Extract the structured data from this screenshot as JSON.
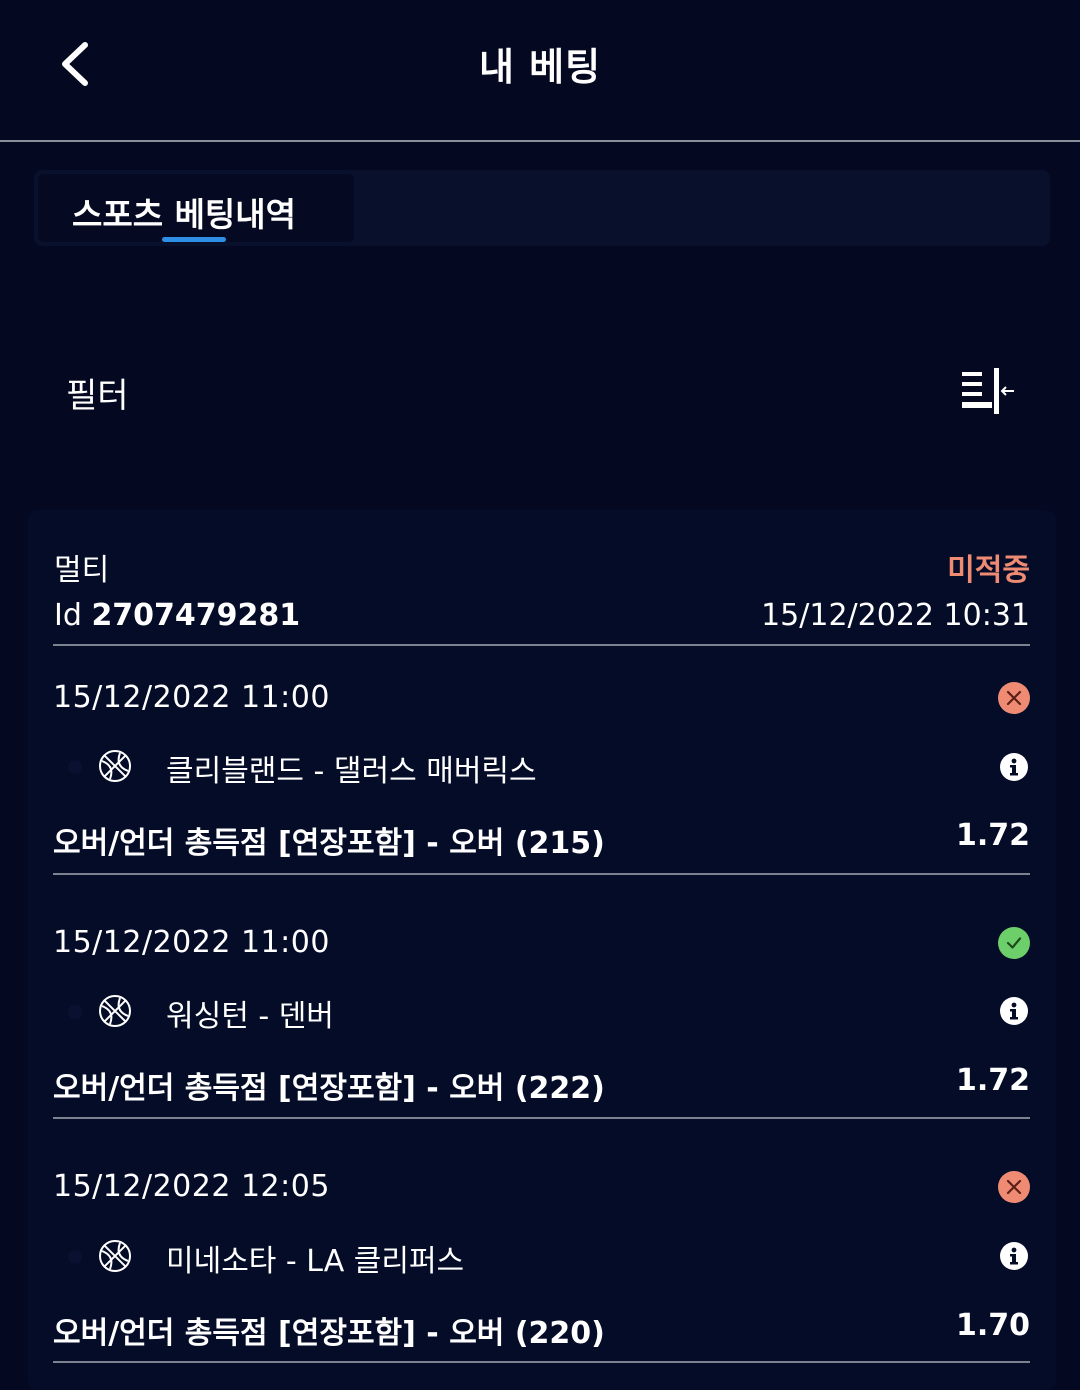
{
  "header": {
    "title": "내 베팅"
  },
  "tabs": [
    {
      "label": "스포츠 베팅내역",
      "active": true
    }
  ],
  "filter": {
    "label": "필터"
  },
  "bet": {
    "type": "멀티",
    "status": "미적중",
    "id_prefix": "Id",
    "id": "2707479281",
    "placed": "15/12/2022 10:31",
    "legs": [
      {
        "time": "15/12/2022 11:00",
        "result": "lost",
        "match": "클리블랜드 - 댈러스 매버릭스",
        "market": "오버/언더 총득점 [연장포함] - 오버 (215)",
        "odds": "1.72"
      },
      {
        "time": "15/12/2022 11:00",
        "result": "won",
        "match": "워싱턴 - 덴버",
        "market": "오버/언더 총득점 [연장포함] - 오버 (222)",
        "odds": "1.72"
      },
      {
        "time": "15/12/2022 12:05",
        "result": "lost",
        "match": "미네소타 - LA 클리퍼스",
        "market": "오버/언더 총득점 [연장포함] - 오버 (220)",
        "odds": "1.70"
      }
    ]
  },
  "colors": {
    "background": "#040820",
    "lost": "#f08b73",
    "won": "#6ccf6a",
    "accent": "#2f8fe6"
  },
  "icons": {
    "back": "chevron-left-icon",
    "filter": "filter-collapse-icon",
    "sport": "basketball-icon",
    "info": "info-icon",
    "lost": "x-circle-icon",
    "won": "check-circle-icon"
  }
}
